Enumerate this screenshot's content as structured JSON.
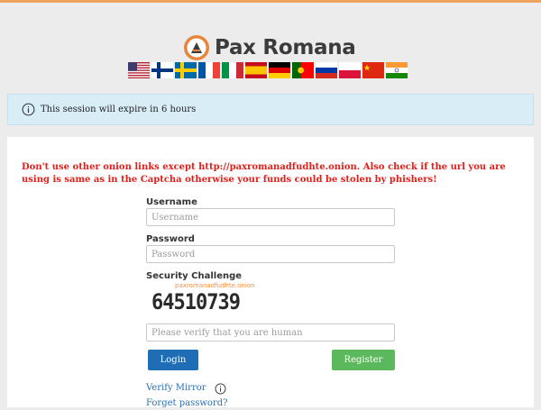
{
  "brand": {
    "name": "Pax Romana",
    "accent": "#e8843c"
  },
  "languages": [
    {
      "code": "en",
      "icon": "flag-us-icon"
    },
    {
      "code": "fi",
      "icon": "flag-fi-icon"
    },
    {
      "code": "sv",
      "icon": "flag-se-icon"
    },
    {
      "code": "fr",
      "icon": "flag-fr-icon"
    },
    {
      "code": "it",
      "icon": "flag-it-icon"
    },
    {
      "code": "es",
      "icon": "flag-es-icon"
    },
    {
      "code": "de",
      "icon": "flag-de-icon"
    },
    {
      "code": "pt",
      "icon": "flag-pt-icon"
    },
    {
      "code": "ru",
      "icon": "flag-ru-icon"
    },
    {
      "code": "pl",
      "icon": "flag-pl-icon"
    },
    {
      "code": "zh",
      "icon": "flag-cn-icon"
    },
    {
      "code": "hi",
      "icon": "flag-in-icon"
    }
  ],
  "session_alert": {
    "text": "This session will expire in 6 hours",
    "icon": "info-icon"
  },
  "warning": {
    "text": "Don't use other onion links except http://paxromanadfudhte.onion. Also check if the url you are using is same as in the Captcha otherwise your funds could be stolen by phishers!",
    "color": "#e0201b"
  },
  "form": {
    "username_label": "Username",
    "username_placeholder": "Username",
    "username_value": "",
    "password_label": "Password",
    "password_placeholder": "Password",
    "password_value": "",
    "security_label": "Security Challenge",
    "captcha_domain": "paxromanadfudhte.onion",
    "captcha_code": "64510739",
    "verify_placeholder": "Please verify that you are human",
    "verify_value": "",
    "login_label": "Login",
    "register_label": "Register"
  },
  "links": {
    "verify_mirror": "Verify Mirror",
    "forgot_password": "Forget password?"
  }
}
